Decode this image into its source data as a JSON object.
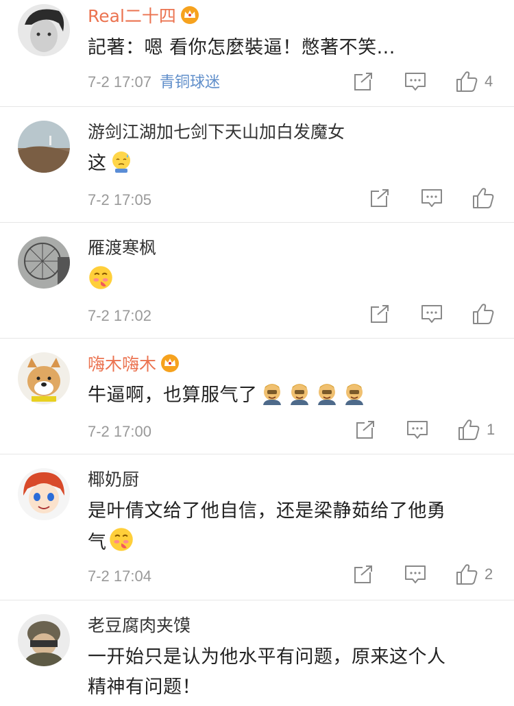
{
  "comments": [
    {
      "username": "Real二十四",
      "vip": true,
      "text": "記著：嗯 看你怎麼裝逼！憋著不笑...",
      "time": "7-2 17:07",
      "tag": "青铜球迷",
      "likes": "4",
      "emojis": []
    },
    {
      "username": "游剑江湖加七剑下天山加白发魔女",
      "vip": false,
      "text": "这",
      "time": "7-2 17:05",
      "tag": "",
      "likes": "",
      "emojis": [
        "sweat-face-emoji"
      ]
    },
    {
      "username": "雁渡寒枫",
      "vip": false,
      "text": "",
      "time": "7-2 17:02",
      "tag": "",
      "likes": "",
      "emojis": [
        "lick-face-emoji"
      ]
    },
    {
      "username": "嗨木嗨木",
      "vip": true,
      "text": "牛逼啊，也算服气了",
      "time": "7-2 17:00",
      "tag": "",
      "likes": "1",
      "emojis": [
        "facepalm-emoji",
        "facepalm-emoji",
        "facepalm-emoji",
        "facepalm-emoji"
      ]
    },
    {
      "username": "椰奶厨",
      "vip": false,
      "text_line1": "是叶倩文给了他自信，还是梁静茹给了他勇",
      "text_line2": "气",
      "time": "7-2 17:04",
      "tag": "",
      "likes": "2",
      "emojis": [
        "lick-face-emoji"
      ]
    },
    {
      "username": "老豆腐肉夹馍",
      "vip": false,
      "text_line1": "一开始只是认为他水平有问题，原来这个人",
      "text_line2": "精神有问题！",
      "time": "",
      "tag": "",
      "likes": "",
      "emojis": []
    }
  ],
  "icons": {
    "share": "share-icon",
    "comment": "comment-icon",
    "like": "thumbs-up-icon",
    "crown": "vip-crown-icon"
  },
  "colors": {
    "vip_name": "#eb7350",
    "tag": "#5f8eca",
    "meta": "#999999",
    "divider": "#e6e6e6"
  }
}
